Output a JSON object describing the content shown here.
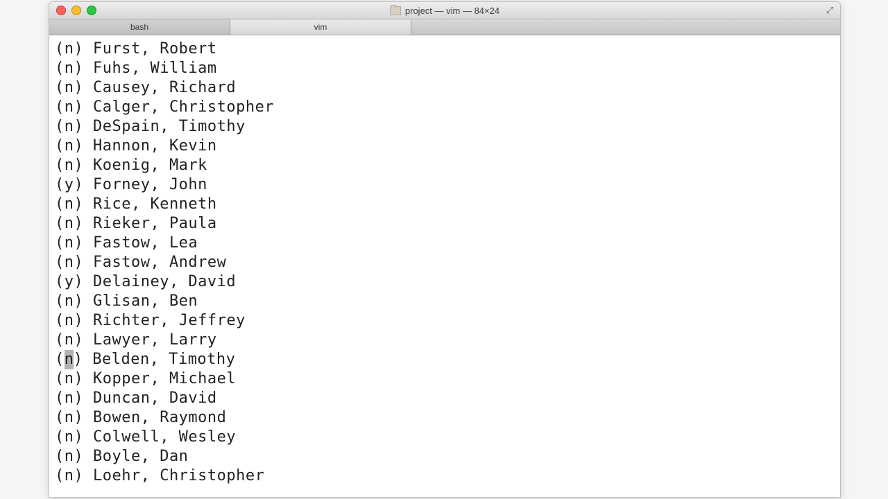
{
  "window": {
    "title": "project — vim — 84×24"
  },
  "tabs": [
    {
      "label": "bash",
      "active": false
    },
    {
      "label": "vim",
      "active": true
    }
  ],
  "cursor_line_index": 16,
  "lines": [
    {
      "flag": "n",
      "name": "Furst, Robert"
    },
    {
      "flag": "n",
      "name": "Fuhs, William"
    },
    {
      "flag": "n",
      "name": "Causey, Richard"
    },
    {
      "flag": "n",
      "name": "Calger, Christopher"
    },
    {
      "flag": "n",
      "name": "DeSpain, Timothy"
    },
    {
      "flag": "n",
      "name": "Hannon, Kevin"
    },
    {
      "flag": "n",
      "name": "Koenig, Mark"
    },
    {
      "flag": "y",
      "name": "Forney, John"
    },
    {
      "flag": "n",
      "name": "Rice, Kenneth"
    },
    {
      "flag": "n",
      "name": "Rieker, Paula"
    },
    {
      "flag": "n",
      "name": "Fastow, Lea"
    },
    {
      "flag": "n",
      "name": "Fastow, Andrew"
    },
    {
      "flag": "y",
      "name": "Delainey, David"
    },
    {
      "flag": "n",
      "name": "Glisan, Ben"
    },
    {
      "flag": "n",
      "name": "Richter, Jeffrey"
    },
    {
      "flag": "n",
      "name": "Lawyer, Larry"
    },
    {
      "flag": "n",
      "name": "Belden, Timothy"
    },
    {
      "flag": "n",
      "name": "Kopper, Michael"
    },
    {
      "flag": "n",
      "name": "Duncan, David"
    },
    {
      "flag": "n",
      "name": "Bowen, Raymond"
    },
    {
      "flag": "n",
      "name": "Colwell, Wesley"
    },
    {
      "flag": "n",
      "name": "Boyle, Dan"
    },
    {
      "flag": "n",
      "name": "Loehr, Christopher"
    }
  ]
}
